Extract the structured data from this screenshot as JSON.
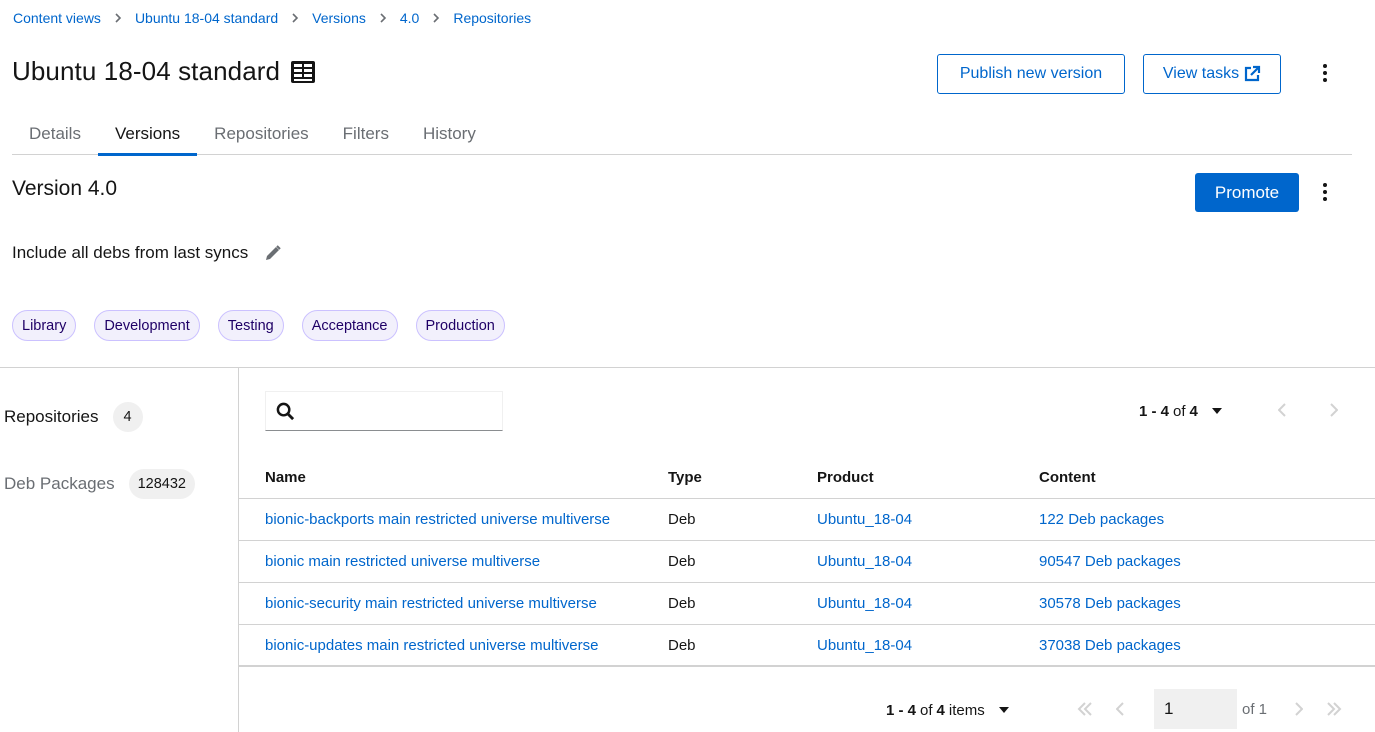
{
  "breadcrumb": [
    "Content views",
    "Ubuntu 18-04 standard",
    "Versions",
    "4.0",
    "Repositories"
  ],
  "title": "Ubuntu 18-04 standard",
  "header_buttons": {
    "publish": "Publish new version",
    "tasks": "View tasks"
  },
  "tabs": [
    "Details",
    "Versions",
    "Repositories",
    "Filters",
    "History"
  ],
  "active_tab": "Versions",
  "version": {
    "title": "Version 4.0",
    "promote_label": "Promote",
    "description": "Include all debs from last syncs",
    "environments": [
      "Library",
      "Development",
      "Testing",
      "Acceptance",
      "Production"
    ]
  },
  "sidebar": [
    {
      "label": "Repositories",
      "count": "4"
    },
    {
      "label": "Deb Packages",
      "count": "128432"
    }
  ],
  "search": {
    "value": ""
  },
  "pager_top": {
    "range": "1 - 4",
    "of": "of",
    "total": "4"
  },
  "table": {
    "headers": [
      "Name",
      "Type",
      "Product",
      "Content"
    ],
    "rows": [
      {
        "name": "bionic-backports main restricted universe multiverse",
        "type": "Deb",
        "product": "Ubuntu_18-04",
        "content": "122 Deb packages"
      },
      {
        "name": "bionic main restricted universe multiverse",
        "type": "Deb",
        "product": "Ubuntu_18-04",
        "content": "90547 Deb packages"
      },
      {
        "name": "bionic-security main restricted universe multiverse",
        "type": "Deb",
        "product": "Ubuntu_18-04",
        "content": "30578 Deb packages"
      },
      {
        "name": "bionic-updates main restricted universe multiverse",
        "type": "Deb",
        "product": "Ubuntu_18-04",
        "content": "37038 Deb packages"
      }
    ]
  },
  "pager_bottom": {
    "range": "1 - 4",
    "of": "of",
    "total": "4",
    "items": "items",
    "page": "1",
    "of_pages": "of 1"
  },
  "colors": {
    "primary": "#0066cc",
    "label_bg": "#f2f0fc",
    "label_border": "#cbc1ff",
    "border": "#d2d2d2"
  }
}
